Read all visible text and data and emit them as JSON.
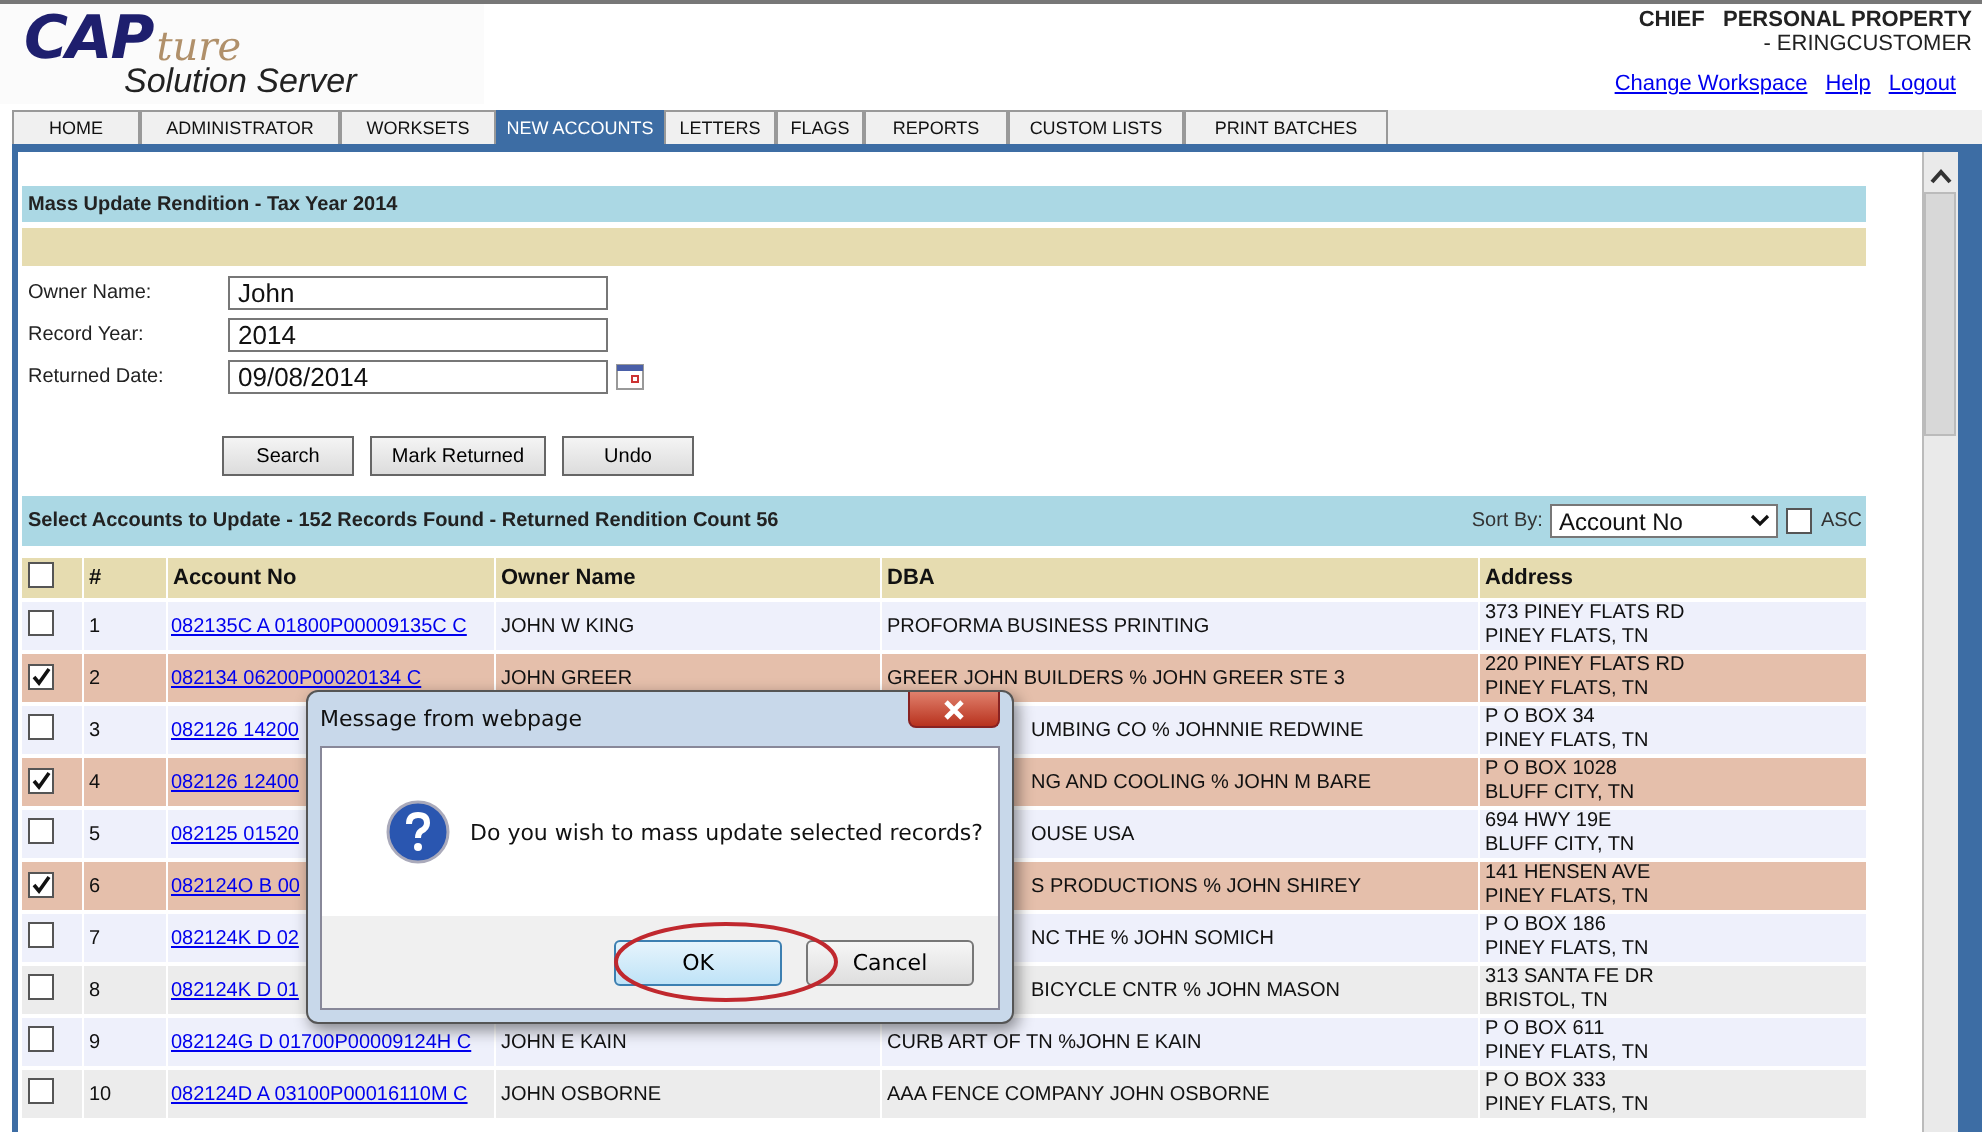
{
  "header": {
    "logo": {
      "main": "CAP",
      "script": "ture",
      "sub": "Solution Server"
    },
    "user": [
      "CHIEF   PERSONAL PROPERTY",
      "- ERINGCUSTOMER"
    ],
    "links": [
      "Change Workspace",
      "Help",
      "Logout"
    ]
  },
  "tabs": [
    {
      "label": "HOME",
      "selected": false
    },
    {
      "label": "ADMINISTRATOR",
      "selected": false
    },
    {
      "label": "WORKSETS",
      "selected": false
    },
    {
      "label": "NEW ACCOUNTS",
      "selected": true
    },
    {
      "label": "LETTERS",
      "selected": false
    },
    {
      "label": "FLAGS",
      "selected": false
    },
    {
      "label": "REPORTS",
      "selected": false
    },
    {
      "label": "CUSTOM LISTS",
      "selected": false
    },
    {
      "label": "PRINT BATCHES",
      "selected": false
    }
  ],
  "form": {
    "title": "Mass Update Rendition - Tax Year 2014",
    "fields": [
      {
        "label": "Owner Name:",
        "value": "John",
        "kind": "text"
      },
      {
        "label": "Record Year:",
        "value": "2014",
        "kind": "text"
      },
      {
        "label": "Returned Date:",
        "value": "09/08/2014",
        "kind": "date"
      }
    ],
    "buttons": [
      "Search",
      "Mark Returned",
      "Undo"
    ]
  },
  "results": {
    "title": "Select Accounts to Update - 152 Records Found - Returned Rendition Count 56",
    "sort_label": "Sort By:",
    "sort_value": "Account No",
    "asc_label": "ASC",
    "asc_checked": false,
    "select_all_checked": false,
    "columns": [
      "#",
      "Account No",
      "Owner Name",
      "DBA",
      "Address"
    ],
    "rows": [
      {
        "checked": false,
        "number": "1",
        "account": "082135C A 01800P00009135C C",
        "owner": "JOHN W KING",
        "dba": "PROFORMA BUSINESS PRINTING",
        "dba_partial": false,
        "address": [
          "373 PINEY FLATS RD",
          "PINEY FLATS, TN"
        ]
      },
      {
        "checked": true,
        "number": "2",
        "account": "082134 06200P00020134 C",
        "owner": "JOHN GREER",
        "dba": "GREER JOHN BUILDERS % JOHN GREER STE 3",
        "dba_partial": false,
        "address": [
          "220 PINEY FLATS RD",
          "PINEY FLATS, TN"
        ]
      },
      {
        "checked": false,
        "number": "3",
        "account": "082126 14200",
        "dba": "UMBING CO % JOHNNIE REDWINE",
        "dba_partial": true,
        "address": [
          "P O BOX 34",
          "PINEY FLATS, TN"
        ]
      },
      {
        "checked": true,
        "number": "4",
        "account": "082126 12400",
        "dba": "NG AND COOLING % JOHN M BARE",
        "dba_partial": true,
        "address": [
          "P O BOX 1028",
          "BLUFF CITY, TN"
        ]
      },
      {
        "checked": false,
        "number": "5",
        "account": "082125 01520",
        "dba": "OUSE USA",
        "dba_partial": true,
        "address": [
          "694 HWY 19E",
          "BLUFF CITY, TN"
        ]
      },
      {
        "checked": true,
        "number": "6",
        "account": "082124O B 00",
        "dba": "S PRODUCTIONS % JOHN SHIREY",
        "dba_partial": true,
        "address": [
          "141 HENSEN AVE",
          "PINEY FLATS, TN"
        ]
      },
      {
        "checked": false,
        "number": "7",
        "account": "082124K D 02",
        "dba": "NC THE % JOHN SOMICH",
        "dba_partial": true,
        "address": [
          "P O BOX 186",
          "PINEY FLATS, TN"
        ]
      },
      {
        "checked": false,
        "number": "8",
        "account": "082124K D 01",
        "dba": "BICYCLE CNTR % JOHN MASON",
        "dba_partial": true,
        "address": [
          "313 SANTA FE DR",
          "BRISTOL, TN"
        ]
      },
      {
        "checked": false,
        "number": "9",
        "account": "082124G D 01700P00009124H C",
        "owner": "JOHN E KAIN",
        "dba": "CURB ART OF TN %JOHN E KAIN",
        "dba_partial": false,
        "address": [
          "P O BOX 611",
          "PINEY FLATS, TN"
        ]
      },
      {
        "checked": false,
        "number": "10",
        "account": "082124D A 03100P00016110M C",
        "owner": "JOHN OSBORNE",
        "dba": "AAA FENCE COMPANY JOHN OSBORNE",
        "dba_partial": false,
        "address": [
          "P O BOX 333",
          "PINEY FLATS, TN"
        ]
      }
    ]
  },
  "dialog": {
    "title": "Message from webpage",
    "message": "Do you wish to mass update selected records?",
    "buttons": [
      {
        "label": "OK",
        "highlighted": true
      },
      {
        "label": "Cancel",
        "highlighted": false
      }
    ]
  }
}
